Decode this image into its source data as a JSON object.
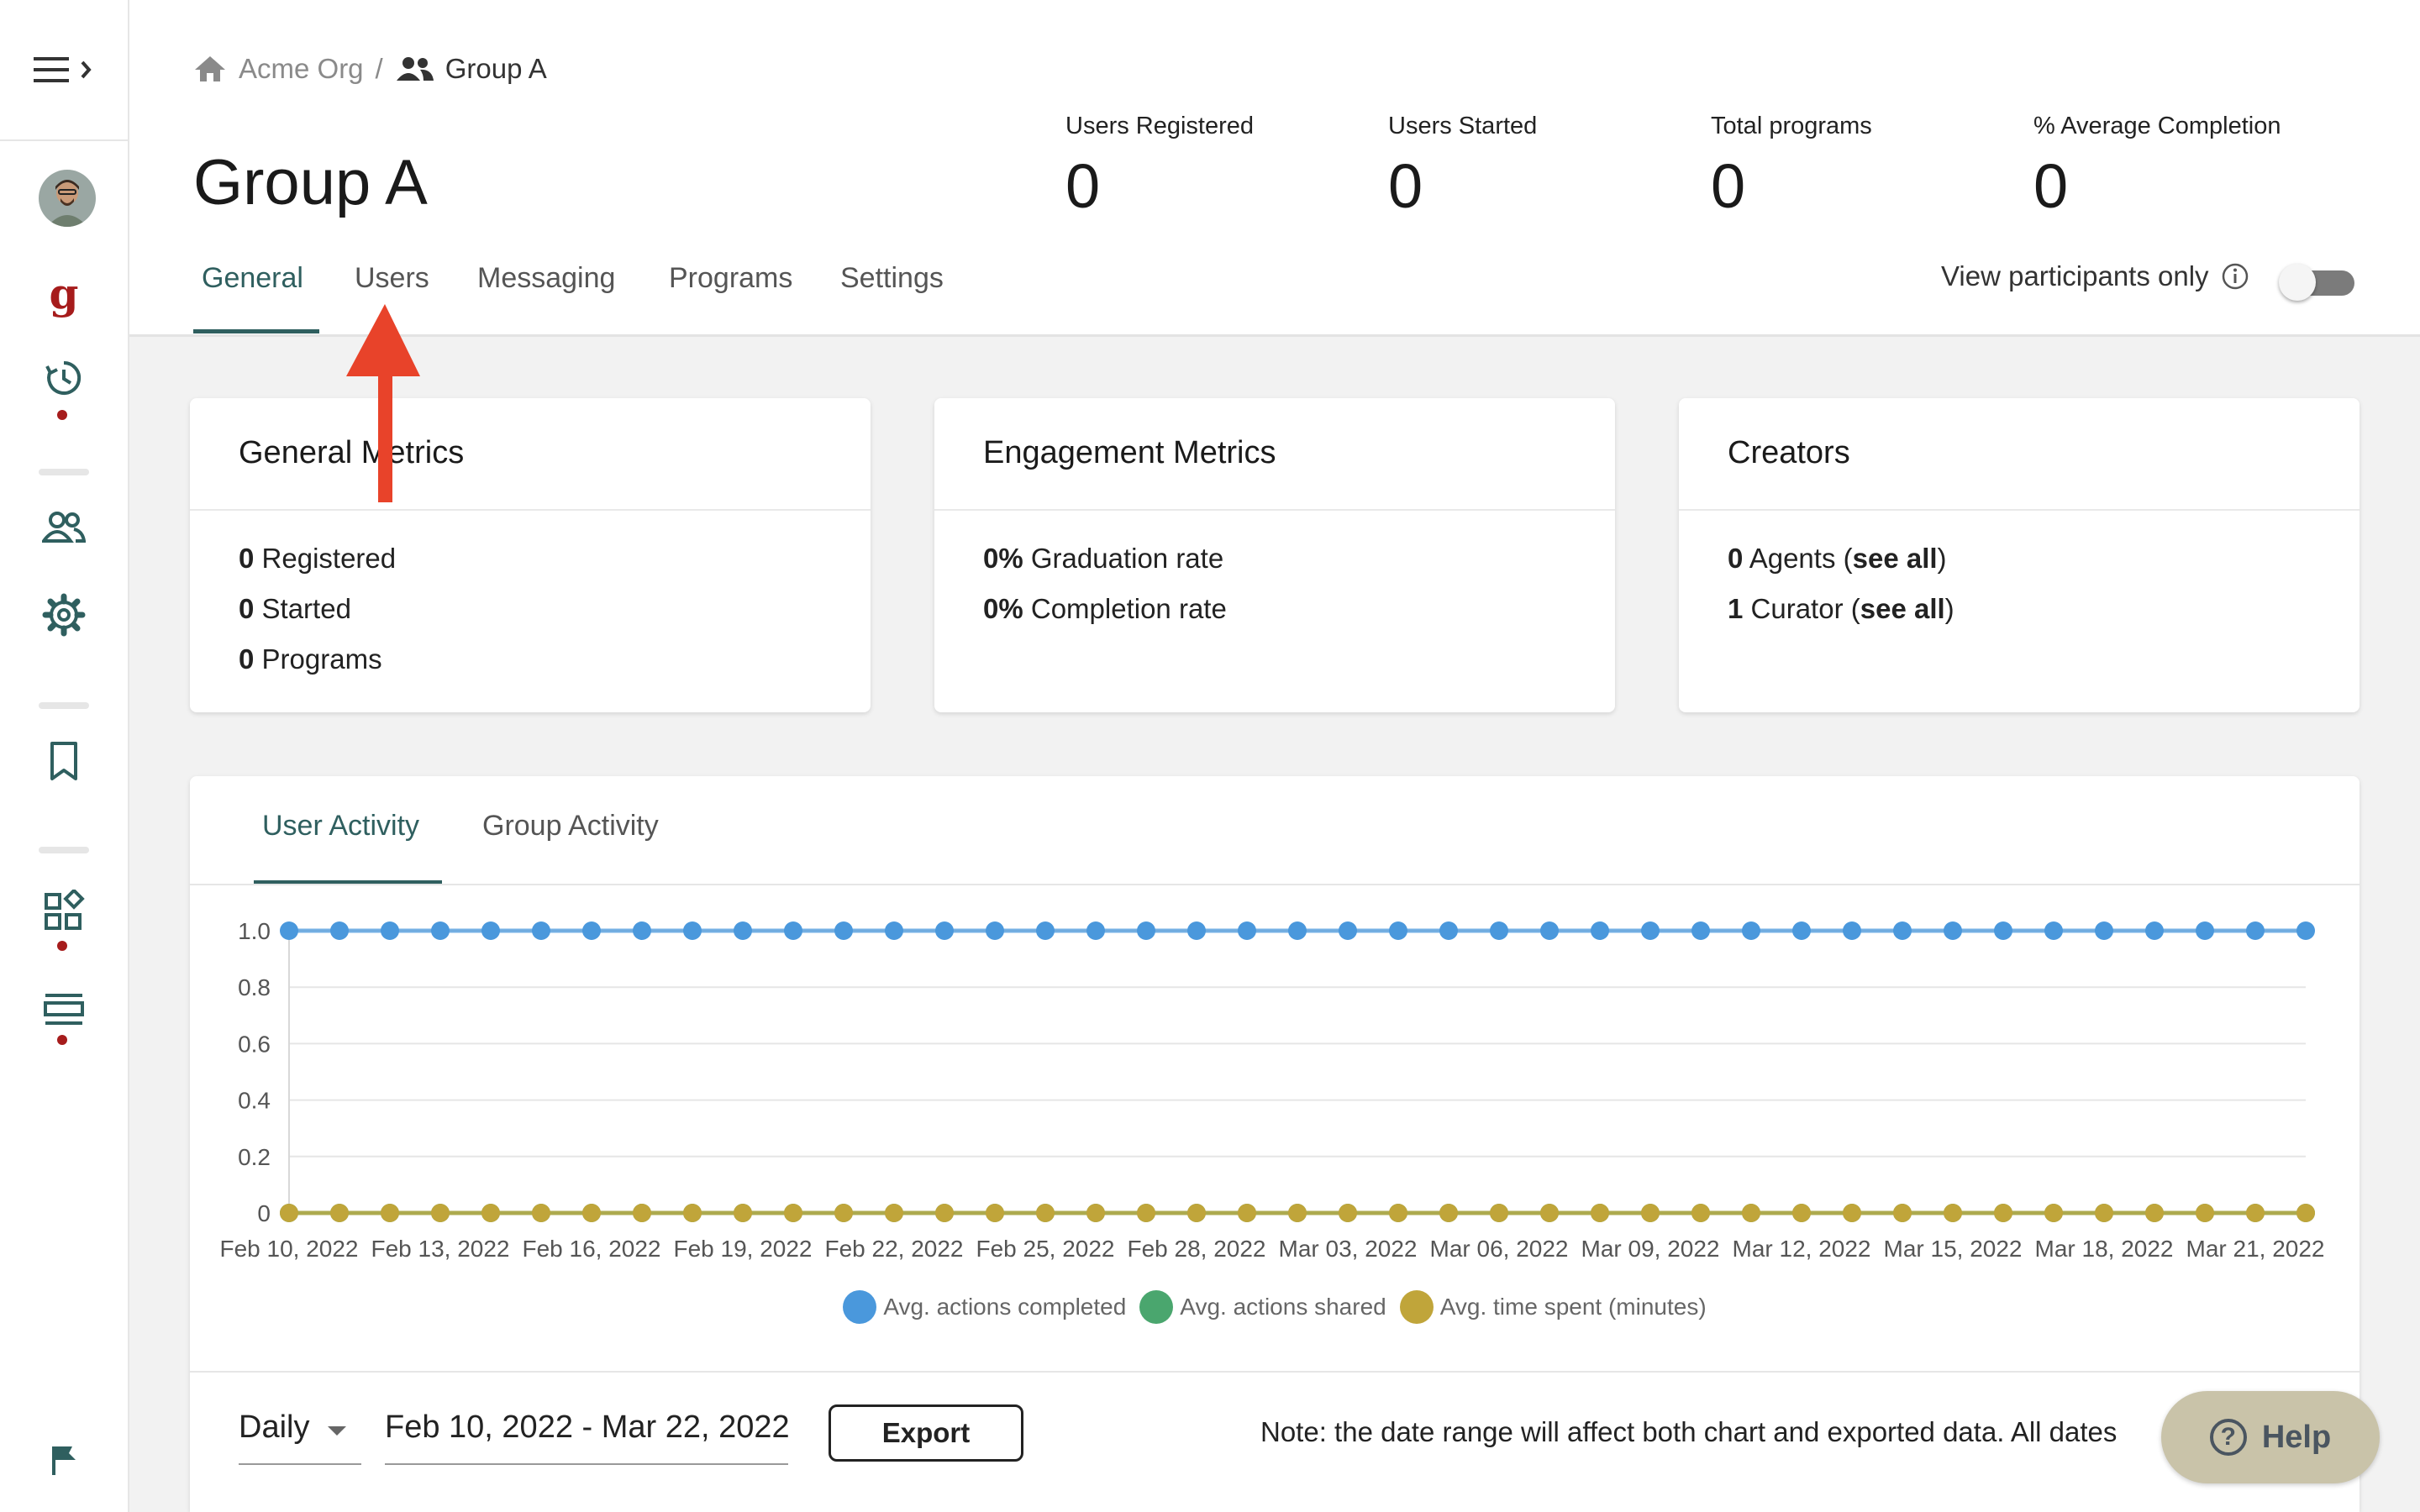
{
  "breadcrumb": {
    "org": "Acme Org",
    "separator": "/",
    "group": "Group A"
  },
  "page_title": "Group A",
  "stats": [
    {
      "label": "Users Registered",
      "value": "0"
    },
    {
      "label": "Users Started",
      "value": "0"
    },
    {
      "label": "Total programs",
      "value": "0"
    },
    {
      "label": "% Average Completion",
      "value": "0"
    }
  ],
  "tabs": [
    "General",
    "Users",
    "Messaging",
    "Programs",
    "Settings"
  ],
  "active_tab": "General",
  "view_participants_only": {
    "label": "View participants only",
    "enabled": false
  },
  "cards": {
    "general": {
      "title": "General Metrics",
      "lines": [
        {
          "value": "0",
          "label": " Registered"
        },
        {
          "value": "0",
          "label": " Started"
        },
        {
          "value": "0",
          "label": " Programs"
        }
      ]
    },
    "engagement": {
      "title": "Engagement Metrics",
      "lines": [
        {
          "value": "0%",
          "label": " Graduation rate"
        },
        {
          "value": "0%",
          "label": " Completion rate"
        }
      ]
    },
    "creators": {
      "title": "Creators",
      "lines": [
        {
          "value": "0",
          "label": " Agents (",
          "link": "see all",
          "tail": ")"
        },
        {
          "value": "1",
          "label": " Curator (",
          "link": "see all",
          "tail": ")"
        }
      ]
    }
  },
  "activity": {
    "tabs": [
      "User Activity",
      "Group Activity"
    ],
    "active_tab": "User Activity",
    "legend": [
      {
        "name": "Avg. actions completed",
        "color": "#4a98dc"
      },
      {
        "name": "Avg. actions shared",
        "color": "#4aa66e"
      },
      {
        "name": "Avg. time spent (minutes)",
        "color": "#c0a53a"
      }
    ],
    "frequency": "Daily",
    "date_range": "Feb 10, 2022 - Mar 22, 2022",
    "export_label": "Export",
    "note": "Note: the date range will affect both chart and exported data. All dates"
  },
  "help_label": "Help",
  "chart_data": {
    "type": "line",
    "x": [
      "2022-02-10",
      "2022-02-11",
      "2022-02-12",
      "2022-02-13",
      "2022-02-14",
      "2022-02-15",
      "2022-02-16",
      "2022-02-17",
      "2022-02-18",
      "2022-02-19",
      "2022-02-20",
      "2022-02-21",
      "2022-02-22",
      "2022-02-23",
      "2022-02-24",
      "2022-02-25",
      "2022-02-26",
      "2022-02-27",
      "2022-02-28",
      "2022-03-01",
      "2022-03-02",
      "2022-03-03",
      "2022-03-04",
      "2022-03-05",
      "2022-03-06",
      "2022-03-07",
      "2022-03-08",
      "2022-03-09",
      "2022-03-10",
      "2022-03-11",
      "2022-03-12",
      "2022-03-13",
      "2022-03-14",
      "2022-03-15",
      "2022-03-16",
      "2022-03-17",
      "2022-03-18",
      "2022-03-19",
      "2022-03-20",
      "2022-03-21",
      "2022-03-22"
    ],
    "x_tick_labels": [
      "Feb 10, 2022",
      "Feb 13, 2022",
      "Feb 16, 2022",
      "Feb 19, 2022",
      "Feb 22, 2022",
      "Feb 25, 2022",
      "Feb 28, 2022",
      "Mar 03, 2022",
      "Mar 06, 2022",
      "Mar 09, 2022",
      "Mar 12, 2022",
      "Mar 15, 2022",
      "Mar 18, 2022",
      "Mar 21, 2022"
    ],
    "y_tick_labels": [
      "0",
      "0.2",
      "0.4",
      "0.6",
      "0.8",
      "1.0"
    ],
    "ylim": [
      0,
      1
    ],
    "grid": true,
    "legend_position": "bottom",
    "series": [
      {
        "name": "Avg. actions completed",
        "color": "#4a98dc",
        "values": [
          1,
          1,
          1,
          1,
          1,
          1,
          1,
          1,
          1,
          1,
          1,
          1,
          1,
          1,
          1,
          1,
          1,
          1,
          1,
          1,
          1,
          1,
          1,
          1,
          1,
          1,
          1,
          1,
          1,
          1,
          1,
          1,
          1,
          1,
          1,
          1,
          1,
          1,
          1,
          1,
          1
        ]
      },
      {
        "name": "Avg. actions shared",
        "color": "#4aa66e",
        "values": [
          0,
          0,
          0,
          0,
          0,
          0,
          0,
          0,
          0,
          0,
          0,
          0,
          0,
          0,
          0,
          0,
          0,
          0,
          0,
          0,
          0,
          0,
          0,
          0,
          0,
          0,
          0,
          0,
          0,
          0,
          0,
          0,
          0,
          0,
          0,
          0,
          0,
          0,
          0,
          0,
          0
        ]
      },
      {
        "name": "Avg. time spent (minutes)",
        "color": "#c0a53a",
        "values": [
          0,
          0,
          0,
          0,
          0,
          0,
          0,
          0,
          0,
          0,
          0,
          0,
          0,
          0,
          0,
          0,
          0,
          0,
          0,
          0,
          0,
          0,
          0,
          0,
          0,
          0,
          0,
          0,
          0,
          0,
          0,
          0,
          0,
          0,
          0,
          0,
          0,
          0,
          0,
          0,
          0
        ]
      }
    ]
  }
}
